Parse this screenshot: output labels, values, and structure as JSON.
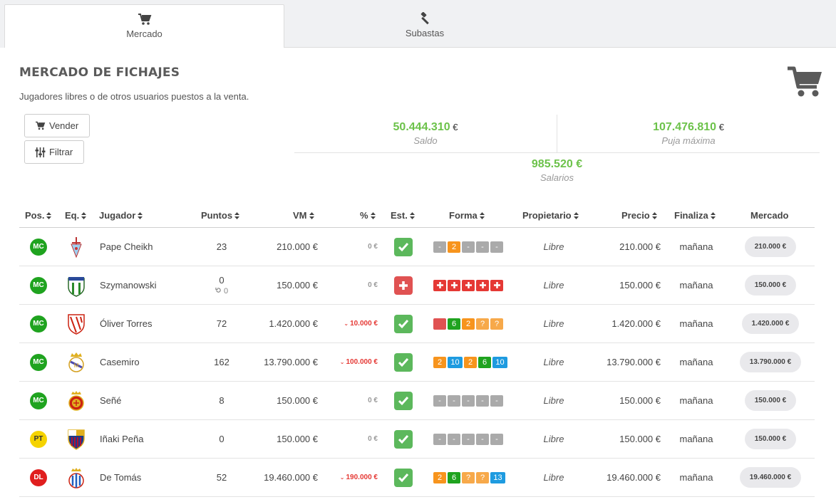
{
  "tabs": [
    {
      "label": "Mercado",
      "icon": "cart-icon",
      "active": true
    },
    {
      "label": "Subastas",
      "icon": "gavel-icon",
      "active": false
    }
  ],
  "header": {
    "title": "MERCADO DE FICHAJES",
    "subtitle": "Jugadores libres o de otros usuarios puestos a la venta."
  },
  "buttons": {
    "sell": "Vender",
    "filter": "Filtrar"
  },
  "stats": {
    "saldo": {
      "value": "50.444.310",
      "currency": "€",
      "label": "Saldo"
    },
    "puja": {
      "value": "107.476.810",
      "currency": "€",
      "label": "Puja máxima"
    },
    "salarios": {
      "value": "985.520 €",
      "label": "Salarios"
    }
  },
  "table": {
    "columns": [
      "Pos.",
      "Eq.",
      "Jugador",
      "Puntos",
      "VM",
      "%",
      "Est.",
      "Forma",
      "Propietario",
      "Precio",
      "Finaliza",
      "Mercado"
    ],
    "rows": [
      {
        "pos": "MC",
        "pos_color": "#1fa31f",
        "team": "Celta",
        "player": "Pape Cheikh",
        "points": "23",
        "points_sub": "",
        "vm": "210.000 €",
        "pct": "0 €",
        "pct_neg": false,
        "status": "ok",
        "forma": [
          {
            "t": "-",
            "c": "#aaaaaa"
          },
          {
            "t": "2",
            "c": "#f7941d"
          },
          {
            "t": "-",
            "c": "#aaaaaa"
          },
          {
            "t": "-",
            "c": "#aaaaaa"
          },
          {
            "t": "-",
            "c": "#aaaaaa"
          }
        ],
        "owner": "Libre",
        "price": "210.000 €",
        "ends": "mañana",
        "market": "210.000 €"
      },
      {
        "pos": "MC",
        "pos_color": "#1fa31f",
        "team": "Leganes",
        "player": "Szymanowski",
        "points": "0",
        "points_sub": "0",
        "vm": "150.000 €",
        "pct": "0 €",
        "pct_neg": false,
        "status": "inj",
        "forma": [
          {
            "t": "+",
            "c": "#e53935"
          },
          {
            "t": "+",
            "c": "#e53935"
          },
          {
            "t": "+",
            "c": "#e53935"
          },
          {
            "t": "+",
            "c": "#e53935"
          },
          {
            "t": "+",
            "c": "#e53935"
          }
        ],
        "owner": "Libre",
        "price": "150.000 €",
        "ends": "mañana",
        "market": "150.000 €"
      },
      {
        "pos": "MC",
        "pos_color": "#1fa31f",
        "team": "Sevilla",
        "player": "Óliver Torres",
        "points": "72",
        "points_sub": "",
        "vm": "1.420.000 €",
        "pct": "10.000 €",
        "pct_neg": true,
        "status": "ok",
        "forma": [
          {
            "t": "",
            "c": "#e05252"
          },
          {
            "t": "6",
            "c": "#1fa31f"
          },
          {
            "t": "2",
            "c": "#f7941d"
          },
          {
            "t": "?",
            "c": "#f7a94a"
          },
          {
            "t": "?",
            "c": "#f7a94a"
          }
        ],
        "owner": "Libre",
        "price": "1.420.000 €",
        "ends": "mañana",
        "market": "1.420.000 €"
      },
      {
        "pos": "MC",
        "pos_color": "#1fa31f",
        "team": "Real Madrid",
        "player": "Casemiro",
        "points": "162",
        "points_sub": "",
        "vm": "13.790.000 €",
        "pct": "100.000 €",
        "pct_neg": true,
        "status": "ok",
        "forma": [
          {
            "t": "2",
            "c": "#f7941d"
          },
          {
            "t": "10",
            "c": "#1e9be0"
          },
          {
            "t": "2",
            "c": "#f7941d"
          },
          {
            "t": "6",
            "c": "#1fa31f"
          },
          {
            "t": "10",
            "c": "#1e9be0"
          }
        ],
        "owner": "Libre",
        "price": "13.790.000 €",
        "ends": "mañana",
        "market": "13.790.000 €"
      },
      {
        "pos": "MC",
        "pos_color": "#1fa31f",
        "team": "Mallorca",
        "player": "Señé",
        "points": "8",
        "points_sub": "",
        "vm": "150.000 €",
        "pct": "0 €",
        "pct_neg": false,
        "status": "ok",
        "forma": [
          {
            "t": "-",
            "c": "#aaaaaa"
          },
          {
            "t": "-",
            "c": "#aaaaaa"
          },
          {
            "t": "-",
            "c": "#aaaaaa"
          },
          {
            "t": "-",
            "c": "#aaaaaa"
          },
          {
            "t": "-",
            "c": "#aaaaaa"
          }
        ],
        "owner": "Libre",
        "price": "150.000 €",
        "ends": "mañana",
        "market": "150.000 €"
      },
      {
        "pos": "PT",
        "pos_color": "#f5d300",
        "team": "Barcelona",
        "player": "Iñaki Peña",
        "points": "0",
        "points_sub": "",
        "vm": "150.000 €",
        "pct": "0 €",
        "pct_neg": false,
        "status": "ok",
        "forma": [
          {
            "t": "-",
            "c": "#aaaaaa"
          },
          {
            "t": "-",
            "c": "#aaaaaa"
          },
          {
            "t": "-",
            "c": "#aaaaaa"
          },
          {
            "t": "-",
            "c": "#aaaaaa"
          },
          {
            "t": "-",
            "c": "#aaaaaa"
          }
        ],
        "owner": "Libre",
        "price": "150.000 €",
        "ends": "mañana",
        "market": "150.000 €"
      },
      {
        "pos": "DL",
        "pos_color": "#e01e1e",
        "team": "Espanyol",
        "player": "De Tomás",
        "points": "52",
        "points_sub": "",
        "vm": "19.460.000 €",
        "pct": "190.000 €",
        "pct_neg": true,
        "status": "ok",
        "forma": [
          {
            "t": "2",
            "c": "#f7941d"
          },
          {
            "t": "6",
            "c": "#1fa31f"
          },
          {
            "t": "?",
            "c": "#f7a94a"
          },
          {
            "t": "?",
            "c": "#f7a94a"
          },
          {
            "t": "13",
            "c": "#1e9be0"
          }
        ],
        "owner": "Libre",
        "price": "19.460.000 €",
        "ends": "mañana",
        "market": "19.460.000 €"
      }
    ]
  }
}
